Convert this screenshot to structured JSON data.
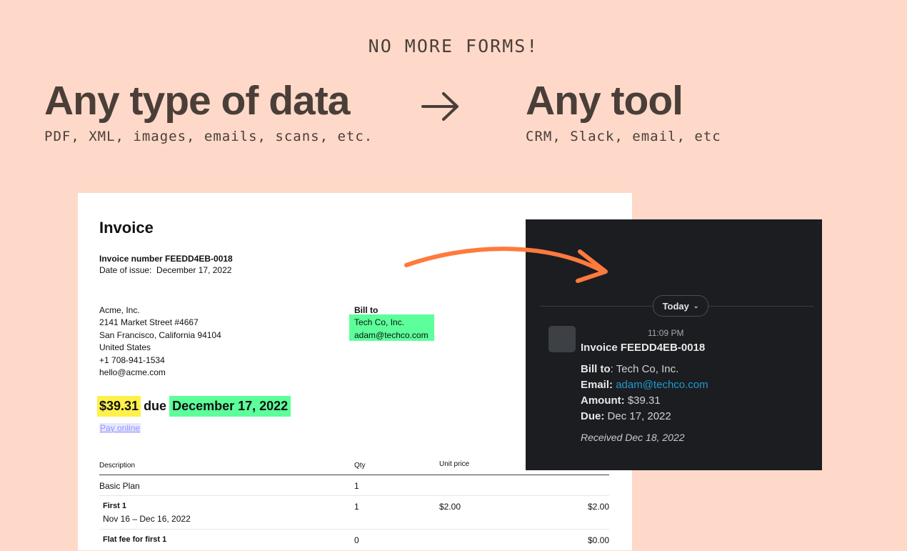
{
  "hero": {
    "eyebrow": "NO MORE FORMS!",
    "left_title": "Any type of data",
    "left_sub": "PDF, XML, images, emails, scans, etc.",
    "right_title": "Any tool",
    "right_sub": "CRM, Slack, email, etc"
  },
  "invoice": {
    "title": "Invoice",
    "number_line": "Invoice number FEEDD4EB-0018",
    "date_label": "Date of issue:",
    "date_value": "December 17, 2022",
    "from": [
      "Acme, Inc.",
      "2141  Market  Street  #4667",
      "San Francisco, California 94104",
      "United States",
      "+1  708-941-1534",
      "hello@acme.com"
    ],
    "bill_to_label": "Bill to",
    "bill_to": [
      "Tech Co,  Inc.",
      "adam@techco.com"
    ],
    "amount": "$39.31",
    "due_word": "due",
    "due_date": "December 17, 2022",
    "pay_online": "Pay online",
    "columns": {
      "description": "Description",
      "qty": "Qty",
      "unit_price": "Unit price"
    },
    "rows": [
      {
        "desc": "Basic   Plan",
        "qty": "1",
        "unit": "",
        "amount": ""
      },
      {
        "desc": "First 1",
        "sub": "Nov 16 – Dec 16, 2022",
        "qty": "1",
        "unit": "$2.00",
        "amount": "$2.00"
      },
      {
        "desc": "Flat fee for first 1",
        "qty": "0",
        "unit": "",
        "amount": "$0.00"
      }
    ]
  },
  "slack": {
    "day_pill": "Today",
    "time": "11:09 PM",
    "title": "Invoice FEEDD4EB-0018",
    "bill_to_label": "Bill to",
    "bill_to_value": ": Tech Co, Inc.",
    "email_label": "Email:",
    "email_value": "adam@techco.com",
    "amount_label": "Amount:",
    "amount_value": "$39.31",
    "due_label": "Due:",
    "due_value": "Dec 17, 2022",
    "received": "Received Dec 18, 2022"
  },
  "colors": {
    "background": "#fed9c9",
    "highlight_yellow": "#fff04a",
    "highlight_green": "#5cff9a",
    "arrow_orange": "#ff7a3d",
    "slack_bg": "#1b1d21",
    "slack_link": "#1d9bd1"
  }
}
